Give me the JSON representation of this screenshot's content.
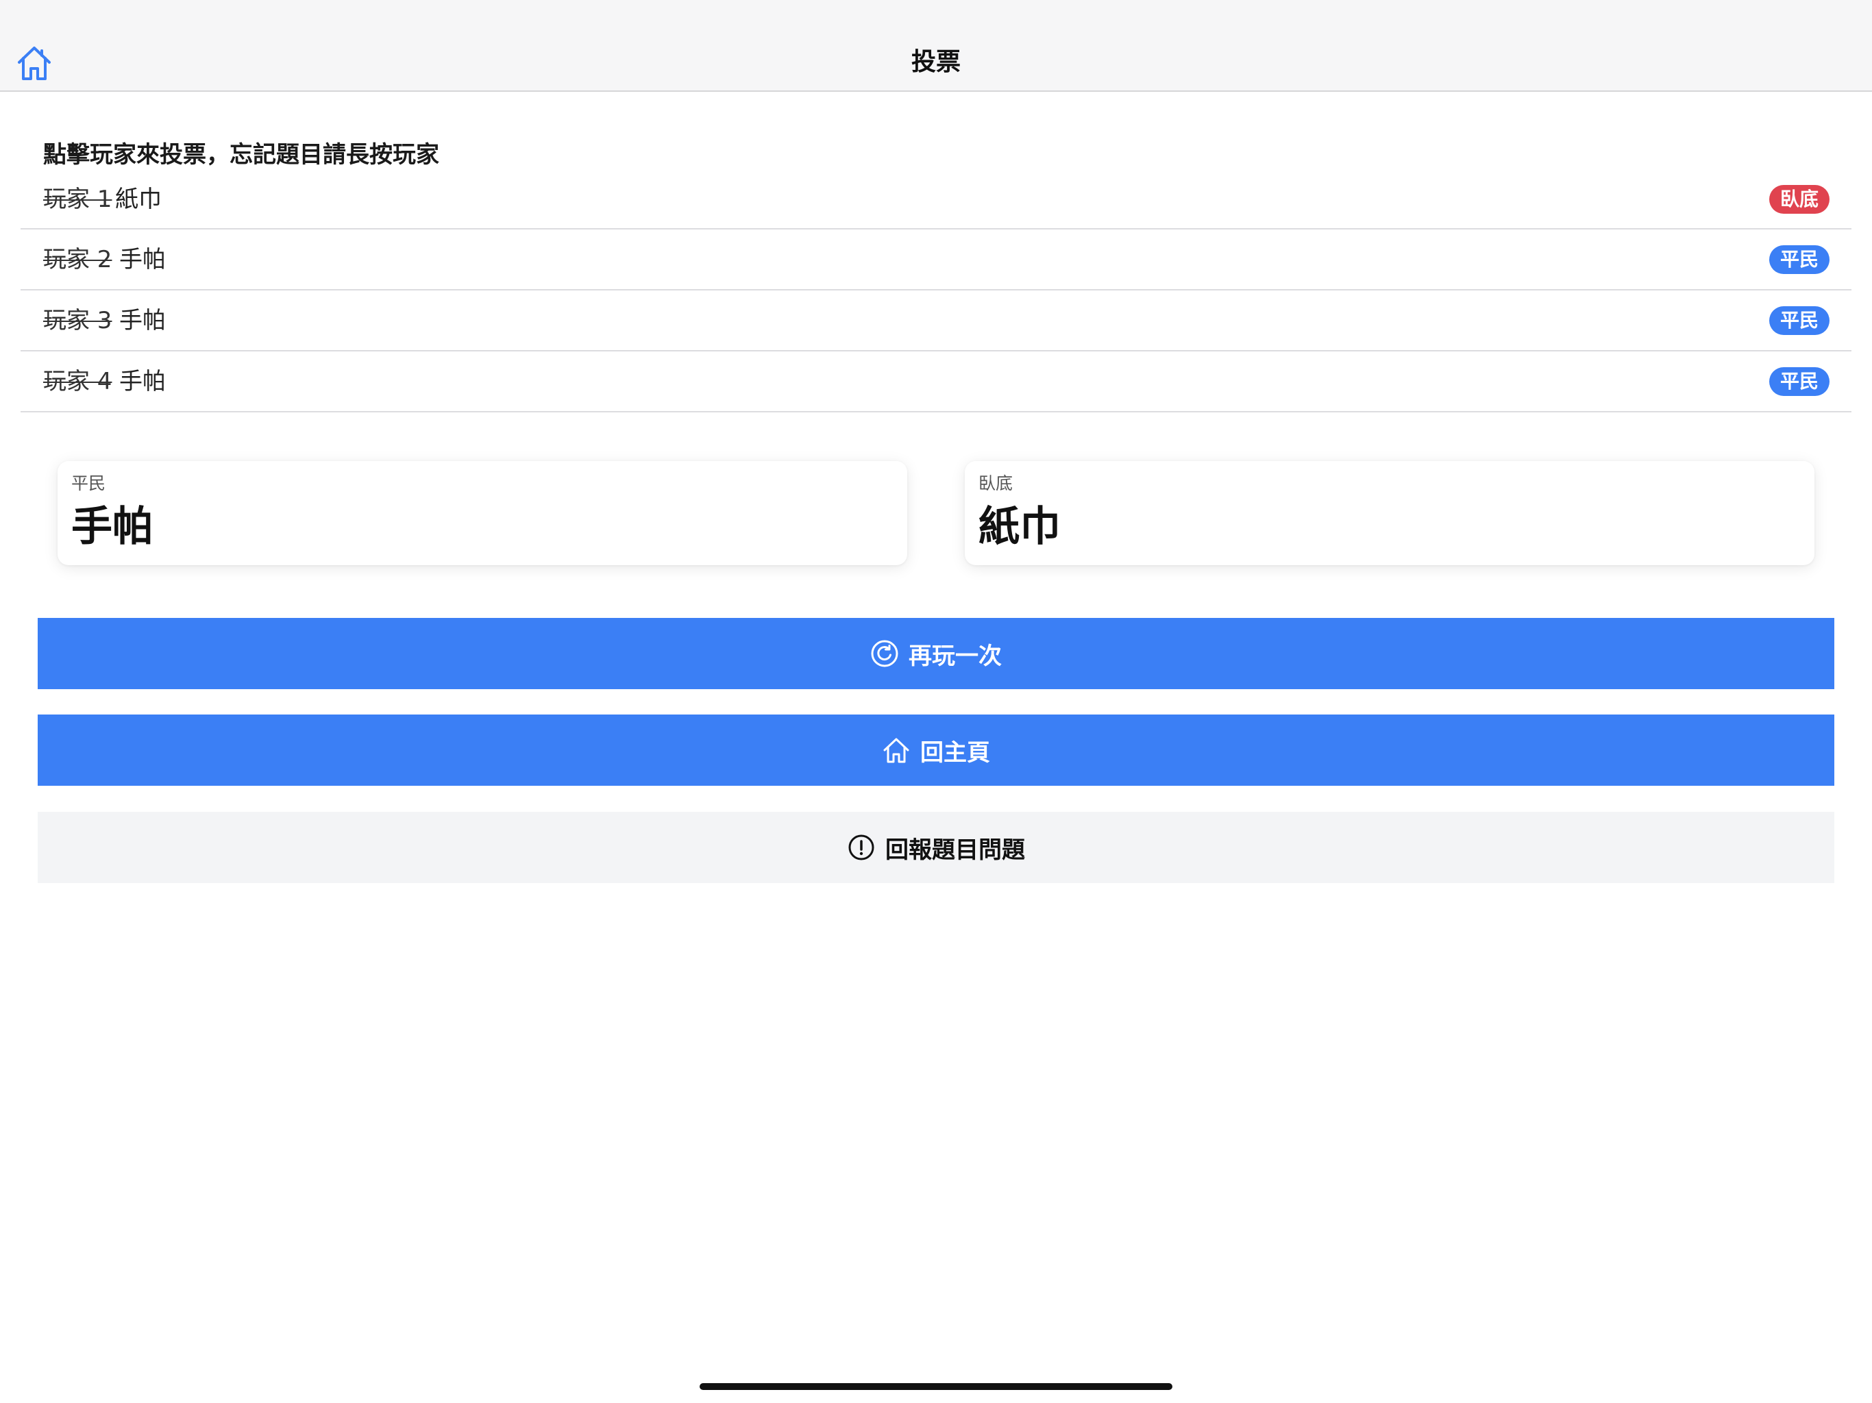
{
  "nav": {
    "title": "投票",
    "home_icon": "home-icon"
  },
  "instructions": "點擊玩家來投票，忘記題目請長按玩家",
  "players": [
    {
      "name": "玩家 1",
      "word": "紙巾",
      "role": "臥底",
      "role_color": "#e0434f"
    },
    {
      "name": "玩家 2",
      "word": "手帕",
      "role": "平民",
      "role_color": "#3b7ff5"
    },
    {
      "name": "玩家 3",
      "word": "手帕",
      "role": "平民",
      "role_color": "#3b7ff5"
    },
    {
      "name": "玩家 4",
      "word": "手帕",
      "role": "平民",
      "role_color": "#3b7ff5"
    }
  ],
  "summary": {
    "civilian": {
      "role": "平民",
      "word": "手帕"
    },
    "undercover": {
      "role": "臥底",
      "word": "紙巾"
    }
  },
  "buttons": {
    "replay": {
      "label": "再玩一次",
      "icon": "replay-icon"
    },
    "home": {
      "label": "回主頁",
      "icon": "home-icon"
    },
    "report": {
      "label": "回報題目問題",
      "icon": "alert-circle-icon"
    }
  },
  "colors": {
    "accent": "#3b7ff5",
    "undercover": "#e0434f",
    "secondary_button": "#f3f4f6",
    "nav_background": "#f6f6f7"
  }
}
